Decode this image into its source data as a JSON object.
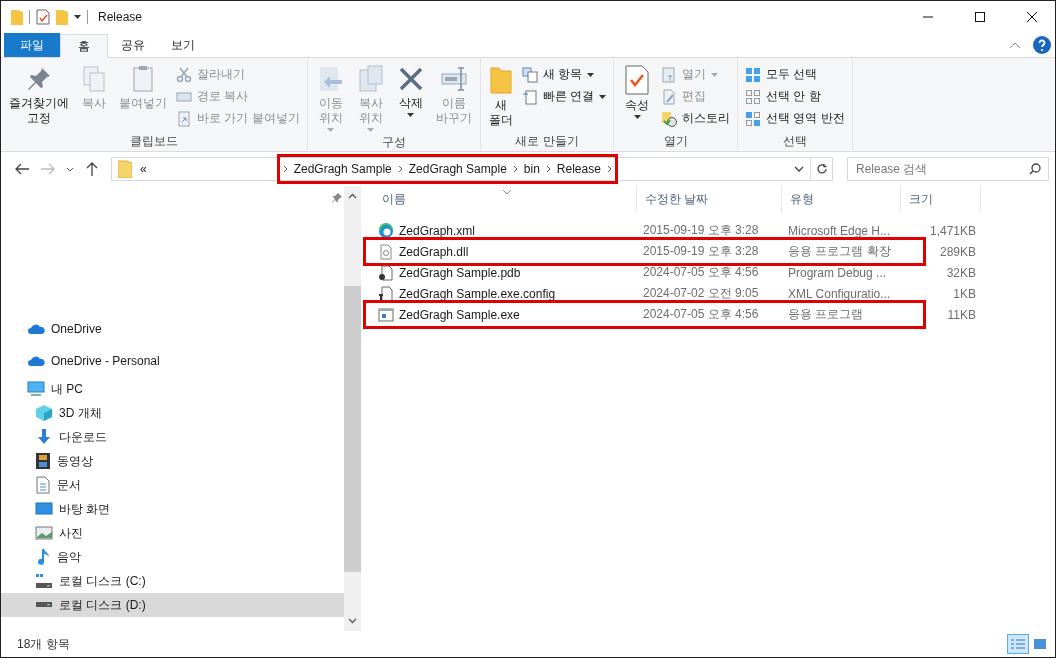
{
  "window": {
    "title": "Release"
  },
  "tabs": [
    {
      "label": "파일",
      "kind": "file",
      "selected": false
    },
    {
      "label": "홈",
      "kind": "tab",
      "selected": true
    },
    {
      "label": "공유",
      "kind": "tab",
      "selected": false
    },
    {
      "label": "보기",
      "kind": "tab",
      "selected": false
    }
  ],
  "ribbon": [
    {
      "label": "클립보드",
      "items": [
        {
          "kind": "large",
          "label": "즐겨찾기에 고정",
          "disabled": false
        },
        {
          "kind": "large",
          "label": "복사",
          "disabled": true
        },
        {
          "kind": "large",
          "label": "붙여넣기",
          "disabled": true
        },
        {
          "kind": "small",
          "label": "잘라내기",
          "disabled": true
        },
        {
          "kind": "small",
          "label": "경로 복사",
          "disabled": true
        },
        {
          "kind": "small",
          "label": "바로 가기 붙여넣기",
          "disabled": true
        }
      ]
    },
    {
      "label": "구성",
      "items": [
        {
          "kind": "large",
          "label": "이동 위치",
          "disabled": true,
          "dropdown": true
        },
        {
          "kind": "large",
          "label": "복사 위치",
          "disabled": true,
          "dropdown": true
        },
        {
          "kind": "large",
          "label": "삭제",
          "disabled": false,
          "dropdown": true
        },
        {
          "kind": "large",
          "label": "이름 바꾸기",
          "disabled": true
        }
      ]
    },
    {
      "label": "새로 만들기",
      "items": [
        {
          "kind": "large",
          "label": "새 폴더",
          "disabled": false
        },
        {
          "kind": "small",
          "label": "새 항목",
          "disabled": false,
          "dropdown": true
        },
        {
          "kind": "small",
          "label": "빠른 연결",
          "disabled": false,
          "dropdown": true
        }
      ]
    },
    {
      "label": "열기",
      "items": [
        {
          "kind": "large",
          "label": "속성",
          "disabled": false,
          "dropdown": true
        },
        {
          "kind": "small",
          "label": "열기",
          "disabled": true,
          "dropdown": true
        },
        {
          "kind": "small",
          "label": "편집",
          "disabled": true
        },
        {
          "kind": "small",
          "label": "히스토리",
          "disabled": false
        }
      ]
    },
    {
      "label": "선택",
      "items": [
        {
          "kind": "small",
          "label": "모두 선택",
          "disabled": false
        },
        {
          "kind": "small",
          "label": "선택 안 함",
          "disabled": false
        },
        {
          "kind": "small",
          "label": "선택 영역 반전",
          "disabled": false
        }
      ]
    }
  ],
  "address": {
    "overflow": "«",
    "breadcrumb": [
      "ZedGragh Sample",
      "ZedGragh Sample",
      "bin",
      "Release"
    ],
    "highlighted": true
  },
  "search": {
    "placeholder": "Release 검색"
  },
  "navigation": [
    {
      "label": "OneDrive",
      "selected": false
    },
    {
      "label": "OneDrive - Personal",
      "selected": false
    },
    {
      "label": "내 PC",
      "selected": false,
      "children": [
        {
          "label": "3D 개체",
          "selected": false
        },
        {
          "label": "다운로드",
          "selected": false
        },
        {
          "label": "동영상",
          "selected": false
        },
        {
          "label": "문서",
          "selected": false
        },
        {
          "label": "바탕 화면",
          "selected": false
        },
        {
          "label": "사진",
          "selected": false
        },
        {
          "label": "음악",
          "selected": false
        },
        {
          "label": "로컬 디스크 (C:)",
          "selected": false
        },
        {
          "label": "로컬 디스크 (D:)",
          "selected": true
        }
      ]
    }
  ],
  "columns": [
    "이름",
    "수정한 날짜",
    "유형",
    "크기"
  ],
  "files": [
    {
      "name": "ZedGraph.xml",
      "date": "2015-09-19 오후 3:28",
      "type": "Microsoft Edge H...",
      "size": "1,471KB",
      "highlighted": false
    },
    {
      "name": "ZedGraph.dll",
      "date": "2015-09-19 오후 3:28",
      "type": "응용 프로그램 확장",
      "size": "289KB",
      "highlighted": true
    },
    {
      "name": "ZedGragh Sample.pdb",
      "date": "2024-07-05 오후 4:56",
      "type": "Program Debug ...",
      "size": "32KB",
      "highlighted": false
    },
    {
      "name": "ZedGragh Sample.exe.config",
      "date": "2024-07-02 오전 9:05",
      "type": "XML Configuratio...",
      "size": "1KB",
      "highlighted": false
    },
    {
      "name": "ZedGragh Sample.exe",
      "date": "2024-07-05 오후 4:56",
      "type": "응용 프로그램",
      "size": "11KB",
      "highlighted": true
    }
  ],
  "status": {
    "count": "18개 항목",
    "views": [
      {
        "kind": "details",
        "selected": true
      },
      {
        "kind": "icons",
        "selected": false
      }
    ]
  }
}
